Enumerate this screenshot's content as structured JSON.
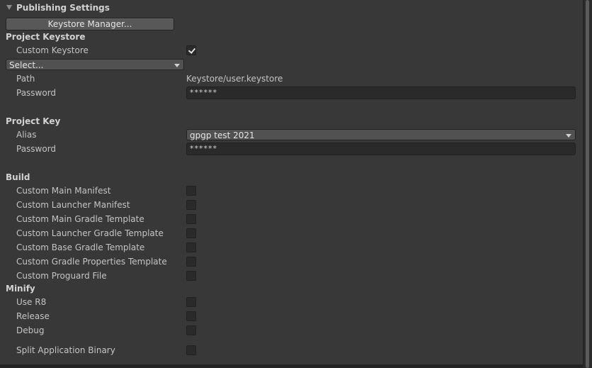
{
  "section_title": "Publishing Settings",
  "keystore_manager_button": "Keystore Manager...",
  "project_keystore": {
    "header": "Project Keystore",
    "custom_keystore_label": "Custom Keystore",
    "custom_keystore_checked": true,
    "select_value": "Select...",
    "path_label": "Path",
    "path_value": "Keystore/user.keystore",
    "password_label": "Password",
    "password_value": "******"
  },
  "project_key": {
    "header": "Project Key",
    "alias_label": "Alias",
    "alias_value": "gpgp test 2021",
    "password_label": "Password",
    "password_value": "******"
  },
  "build": {
    "header": "Build",
    "items": [
      {
        "label": "Custom Main Manifest",
        "checked": false
      },
      {
        "label": "Custom Launcher Manifest",
        "checked": false
      },
      {
        "label": "Custom Main Gradle Template",
        "checked": false
      },
      {
        "label": "Custom Launcher Gradle Template",
        "checked": false
      },
      {
        "label": "Custom Base Gradle Template",
        "checked": false
      },
      {
        "label": "Custom Gradle Properties Template",
        "checked": false
      },
      {
        "label": "Custom Proguard File",
        "checked": false
      }
    ]
  },
  "minify": {
    "header": "Minify",
    "items": [
      {
        "label": "Use R8",
        "checked": false
      },
      {
        "label": "Release",
        "checked": false
      },
      {
        "label": "Debug",
        "checked": false
      }
    ]
  },
  "split_binary": {
    "label": "Split Application Binary",
    "checked": false
  }
}
